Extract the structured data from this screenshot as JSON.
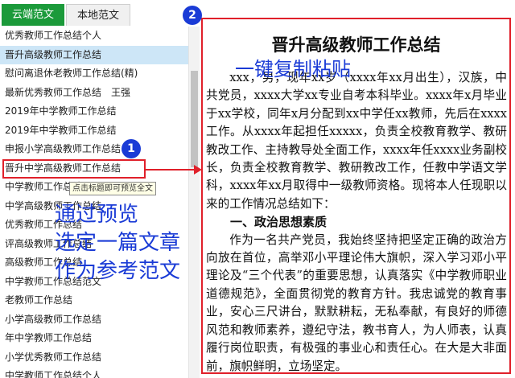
{
  "tabs": {
    "cloud": "云端范文",
    "local": "本地范文"
  },
  "list": {
    "items": [
      {
        "label": "优秀教师工作总结个人"
      },
      {
        "label": "晋升高级教师工作总结"
      },
      {
        "label": "慰问离退休老教师工作总结(精)"
      },
      {
        "label": "最新优秀教师工作总结　王强"
      },
      {
        "label": "2019年中学教师工作总结"
      },
      {
        "label": "2019年中学教师工作总结"
      },
      {
        "label": "申报小学高级教师工作总结"
      },
      {
        "label": "晋升中学高级教师工作总结"
      },
      {
        "label": "中学教师工作总结"
      },
      {
        "label": "中学高级教师工作总结"
      },
      {
        "label": "优秀教师工作总结"
      },
      {
        "label": "评高级教师工作总结"
      },
      {
        "label": "高级教师工作总结"
      },
      {
        "label": "中学教师工作总结范文"
      },
      {
        "label": "老教师工作总结"
      },
      {
        "label": "小学高级教师工作总结"
      },
      {
        "label": "年中学教师工作总结"
      },
      {
        "label": "小学优秀教师工作总结"
      },
      {
        "label": "中学教师工作总结个人"
      }
    ],
    "selected_index": 1
  },
  "tooltip": "点击标题即可预览全文",
  "annotations": {
    "badge_1": "1",
    "badge_2": "2",
    "left_line_1": "通过预览",
    "left_line_2": "选定一篇文章",
    "left_line_3": "作为参考范文",
    "doc_overlay": "一键复制粘贴"
  },
  "colors": {
    "accent_green": "#1b9a3a",
    "annotation_red": "#e0202a",
    "annotation_blue": "#1a3bd6",
    "selected_row": "#cde6f7"
  },
  "document": {
    "title": "晋升高级教师工作总结",
    "p1": "xxx，男，现年xx岁（xxxx年xx月出生），汉族，中共党员，xxxx大学xx专业自考本科毕业。xxxx年x月毕业于xx学校，同年x月分配到xx中学任xx教师，先后在xxxx工作。从xxxx年起担任xxxxx，负责全校教育教学、教研教改工作、主持教导处全面工作，xxxx年任xxxx业务副校长，负责全校教育教学、教研教改工作，任教中学语文学科，xxxx年xx月取得中一级教师资格。现将本人任现职以来的工作情况总结如下：",
    "section1": "一、政治思想素质",
    "p2": "作为一名共产党员，我始终坚持把坚定正确的政治方向放在首位，高举邓小平理论伟大旗帜，深入学习邓小平理论及“三个代表”的重要思想，认真落实《中学教师职业道德规范》，全面贯彻党的教育方针。我忠诚党的教育事业，安心三尺讲台，默默耕耘，无私奉献，有良好的师德风范和教师素养，遵纪守法，教书育人，为人师表，认真履行岗位职责，有极强的事业心和责任心。在大是大非面前，旗帜鲜明，立场坚定。"
  }
}
